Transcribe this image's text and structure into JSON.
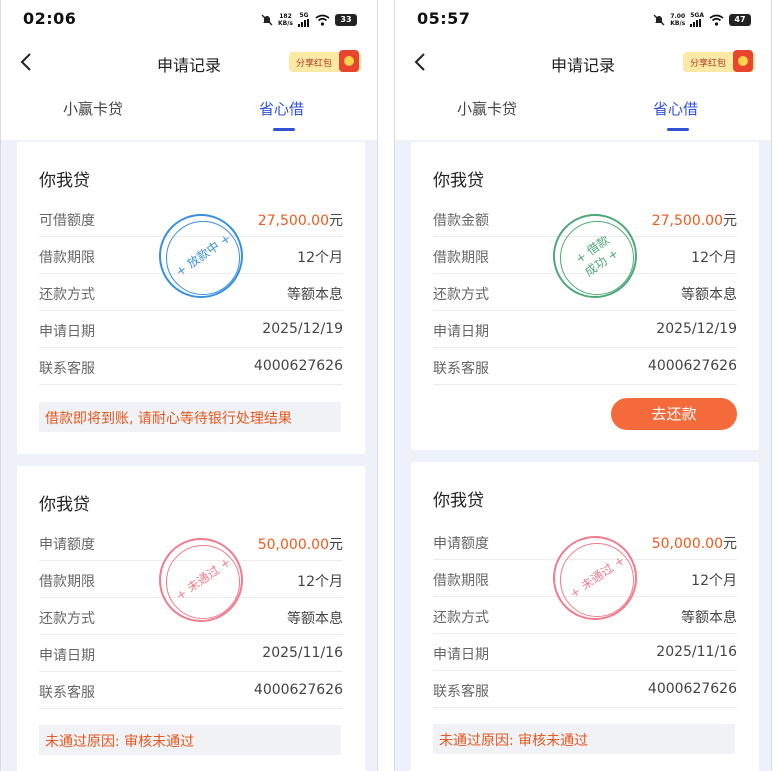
{
  "colors": {
    "accent": "#3251d6",
    "amount": "#ef5a1c",
    "stamp_blue": "#3a8fe0",
    "stamp_green": "#4fa87a",
    "stamp_pink": "#ee7d8e",
    "pay_button": "#f46a3a"
  },
  "screens": [
    {
      "status": {
        "time": "02:06",
        "speed_top": "182",
        "speed_bottom": "KB/s",
        "net_top": "5G",
        "net_bottom": "il",
        "battery": "33"
      },
      "nav": {
        "title": "申请记录",
        "share_label": "分享红包"
      },
      "tabs": [
        {
          "label": "小赢卡贷"
        },
        {
          "label": "省心借"
        }
      ],
      "cards": [
        {
          "brand": "你我贷",
          "rows": [
            {
              "label": "可借额度",
              "value": "27,500.00",
              "unit": "元"
            },
            {
              "label": "借款期限",
              "value": "12个月"
            },
            {
              "label": "还款方式",
              "value": "等额本息"
            },
            {
              "label": "申请日期",
              "value": "2025/12/19"
            },
            {
              "label": "联系客服",
              "value": "4000627626"
            }
          ],
          "stamp": "+ 放款中 +",
          "note": "借款即将到账, 请耐心等待银行处理结果"
        },
        {
          "brand": "你我贷",
          "rows": [
            {
              "label": "申请额度",
              "value": "50,000.00",
              "unit": "元"
            },
            {
              "label": "借款期限",
              "value": "12个月"
            },
            {
              "label": "还款方式",
              "value": "等额本息"
            },
            {
              "label": "申请日期",
              "value": "2025/11/16"
            },
            {
              "label": "联系客服",
              "value": "4000627626"
            }
          ],
          "stamp": "+ 未通过 +",
          "note": "未通过原因: 审核未通过"
        }
      ]
    },
    {
      "status": {
        "time": "05:57",
        "speed_top": "7.00",
        "speed_bottom": "KB/s",
        "net_top": "5GA",
        "net_bottom": "il",
        "battery": "47"
      },
      "nav": {
        "title": "申请记录",
        "share_label": "分享红包"
      },
      "tabs": [
        {
          "label": "小赢卡贷"
        },
        {
          "label": "省心借"
        }
      ],
      "cards": [
        {
          "brand": "你我贷",
          "rows": [
            {
              "label": "借款金额",
              "value": "27,500.00",
              "unit": "元"
            },
            {
              "label": "借款期限",
              "value": "12个月"
            },
            {
              "label": "还款方式",
              "value": "等额本息"
            },
            {
              "label": "申请日期",
              "value": "2025/12/19"
            },
            {
              "label": "联系客服",
              "value": "4000627626"
            }
          ],
          "stamp": "+ 借款\n成功 +",
          "button": "去还款"
        },
        {
          "brand": "你我贷",
          "rows": [
            {
              "label": "申请额度",
              "value": "50,000.00",
              "unit": "元"
            },
            {
              "label": "借款期限",
              "value": "12个月"
            },
            {
              "label": "还款方式",
              "value": "等额本息"
            },
            {
              "label": "申请日期",
              "value": "2025/11/16"
            },
            {
              "label": "联系客服",
              "value": "4000627626"
            }
          ],
          "stamp": "+ 未通过 +",
          "note": "未通过原因: 审核未通过"
        }
      ]
    }
  ]
}
